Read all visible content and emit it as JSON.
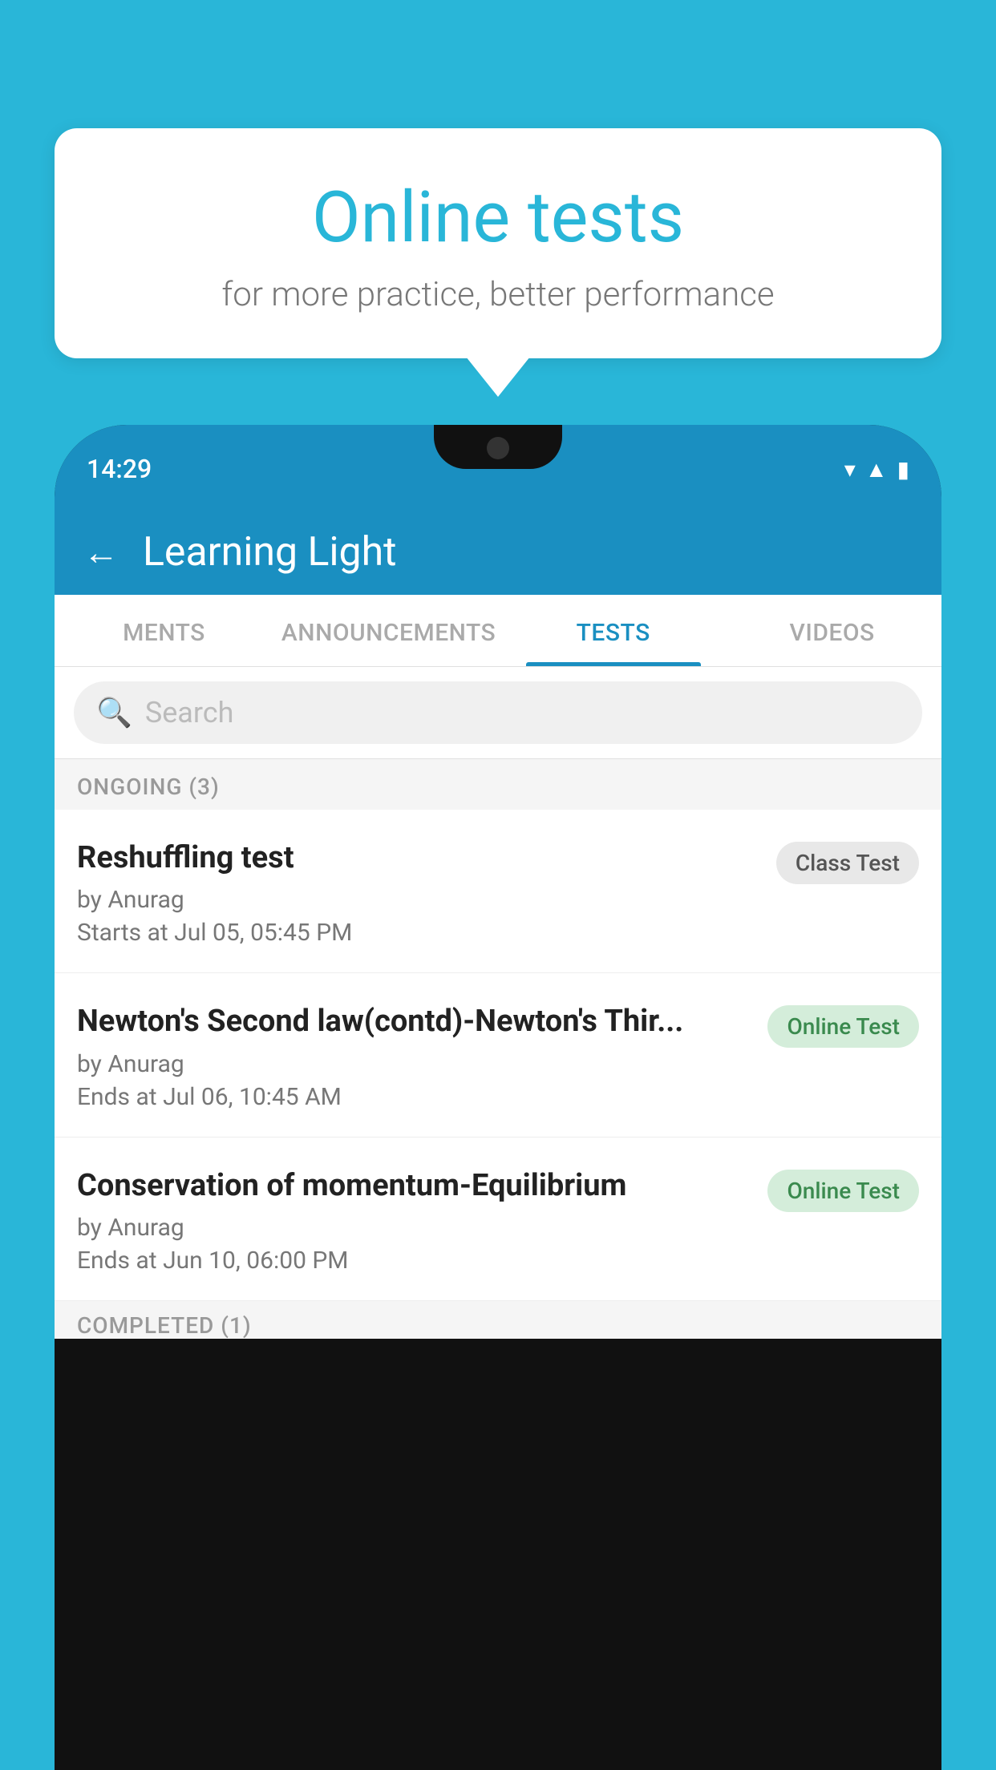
{
  "background_color": "#29b6d8",
  "bubble": {
    "title": "Online tests",
    "subtitle": "for more practice, better performance"
  },
  "phone": {
    "status": {
      "time": "14:29"
    },
    "app_header": {
      "title": "Learning Light"
    },
    "tabs": [
      {
        "label": "MENTS",
        "active": false
      },
      {
        "label": "ANNOUNCEMENTS",
        "active": false
      },
      {
        "label": "TESTS",
        "active": true
      },
      {
        "label": "VIDEOS",
        "active": false
      }
    ],
    "search": {
      "placeholder": "Search"
    },
    "ongoing_section": {
      "label": "ONGOING (3)",
      "items": [
        {
          "name": "Reshuffling test",
          "author": "by Anurag",
          "time_label": "Starts at",
          "time": "Jul 05, 05:45 PM",
          "tag": "Class Test",
          "tag_type": "class"
        },
        {
          "name": "Newton's Second law(contd)-Newton's Thir...",
          "author": "by Anurag",
          "time_label": "Ends at",
          "time": "Jul 06, 10:45 AM",
          "tag": "Online Test",
          "tag_type": "online"
        },
        {
          "name": "Conservation of momentum-Equilibrium",
          "author": "by Anurag",
          "time_label": "Ends at",
          "time": "Jun 10, 06:00 PM",
          "tag": "Online Test",
          "tag_type": "online"
        }
      ]
    },
    "completed_section": {
      "label": "COMPLETED (1)"
    }
  }
}
